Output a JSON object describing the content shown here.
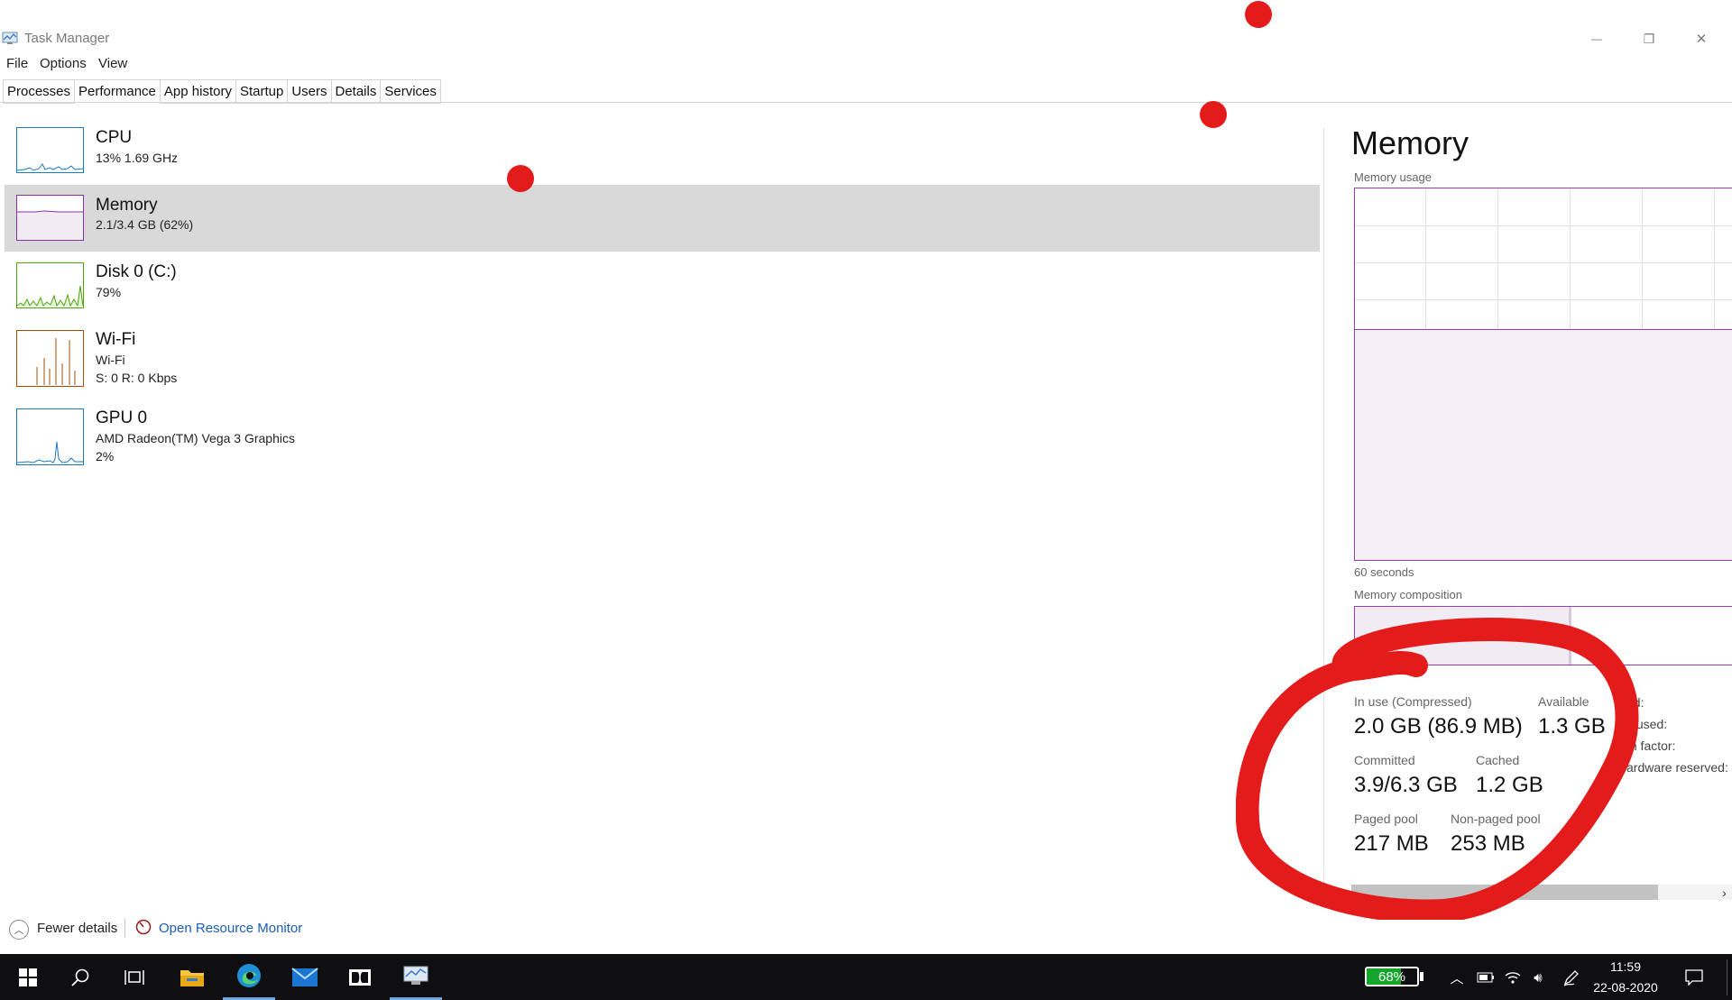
{
  "window": {
    "title": "Task Manager",
    "minimize_glyph": "—",
    "maximize_glyph": "❐",
    "close_glyph": "✕"
  },
  "menu": [
    "File",
    "Options",
    "View"
  ],
  "tabs": [
    "Processes",
    "Performance",
    "App history",
    "Startup",
    "Users",
    "Details",
    "Services"
  ],
  "active_tab": "Performance",
  "resources": [
    {
      "name": "CPU",
      "line1": "13%  1.69 GHz",
      "color": "#1979c6"
    },
    {
      "name": "Memory",
      "line1": "2.1/3.4 GB (62%)",
      "color": "#8b2fa8"
    },
    {
      "name": "Disk 0 (C:)",
      "line1": "79%",
      "color": "#4da60c"
    },
    {
      "name": "Wi-Fi",
      "line1": "Wi-Fi",
      "line2": "S: 0  R: 0 Kbps",
      "color": "#a74f01"
    },
    {
      "name": "GPU 0",
      "line1": "AMD Radeon(TM) Vega 3 Graphics",
      "line2": "2%",
      "color": "#1979c6"
    }
  ],
  "detail": {
    "title": "Memory",
    "usage_label": "Memory usage",
    "usage_level": 0.62,
    "seconds_label": "60 seconds",
    "composition_label": "Memory composition",
    "composition_inuse_fraction": 0.55,
    "stats": {
      "in_use_label": "In use (Compressed)",
      "in_use_value": "2.0 GB (86.9 MB)",
      "available_label": "Available",
      "available_value": "1.3 GB",
      "committed_label": "Committed",
      "committed_value": "3.9/6.3 GB",
      "cached_label": "Cached",
      "cached_value": "1.2 GB",
      "paged_label": "Paged pool",
      "paged_value": "217 MB",
      "nonpaged_label": "Non-paged pool",
      "nonpaged_value": "253 MB"
    },
    "side_labels": [
      "ed:",
      "s used:",
      "m factor:",
      "ardware reserved:"
    ]
  },
  "footer": {
    "fewer_details": "Fewer details",
    "resource_monitor": "Open Resource Monitor"
  },
  "taskbar": {
    "battery_label": "68%",
    "battery_level": 0.68,
    "time": "11:59",
    "date": "22-08-2020",
    "accent": "#14a52b"
  },
  "colors": {
    "memory_accent": "#9c3ab1",
    "annotation_red": "#e31b1b",
    "link": "#1a5fb4"
  }
}
